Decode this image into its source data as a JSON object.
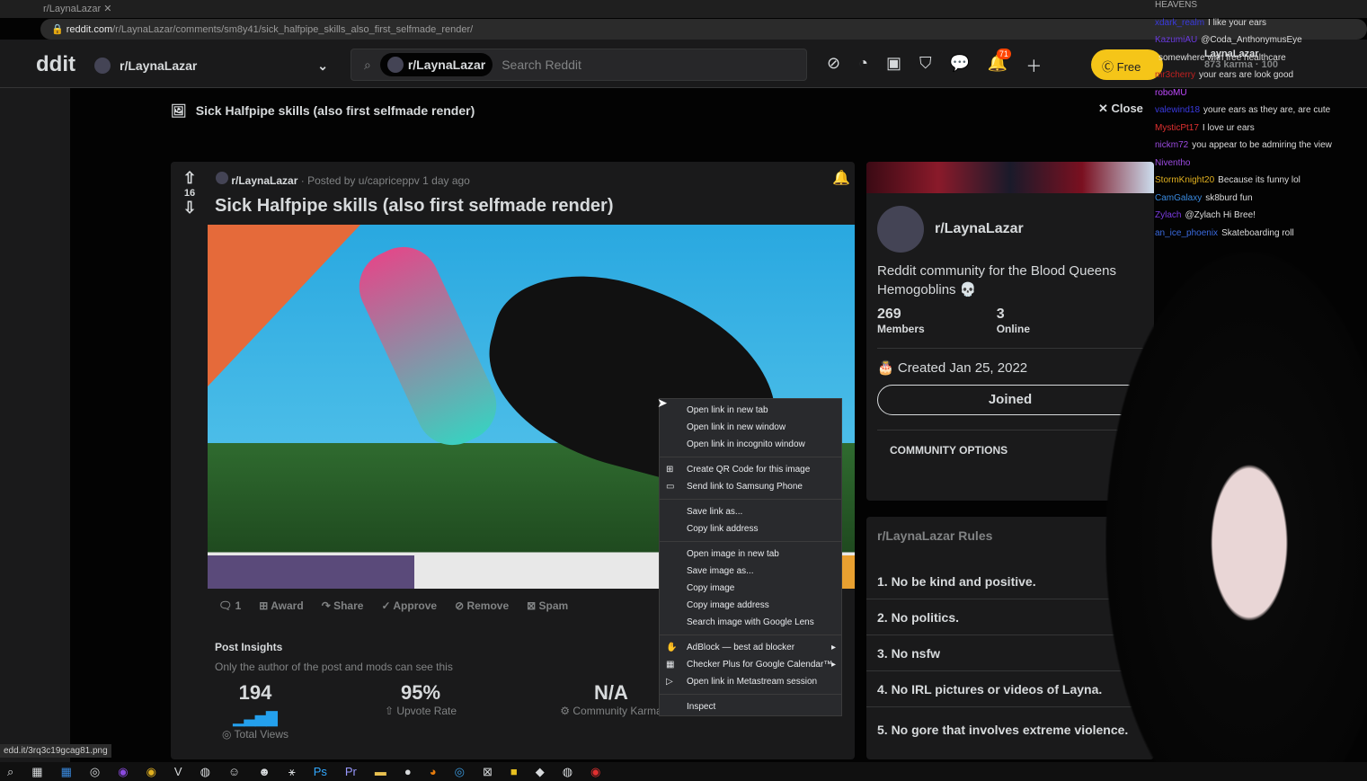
{
  "browser": {
    "tab_title": "r/LaynaLazar",
    "url_domain": "reddit.com",
    "url_path": "/r/LaynaLazar/comments/sm8y41/sick_halfpipe_skills_also_first_selfmade_render/"
  },
  "header": {
    "logo": "ddit",
    "community": "r/LaynaLazar",
    "search_scope": "r/LaynaLazar",
    "search_placeholder": "Search Reddit",
    "notifications": "71",
    "free_label": "Free",
    "user": "LaynaLazar",
    "karma": "873 karma",
    "coins": "100"
  },
  "post_header": {
    "title": "Sick Halfpipe skills (also first selfmade render)",
    "close": "Close"
  },
  "post": {
    "votes": "16",
    "subreddit": "r/LaynaLazar",
    "posted_by": "· Posted by u/capriceppv 1 day ago",
    "title": "Sick Halfpipe skills (also first selfmade render)",
    "actions": [
      {
        "icon": "comment-icon",
        "label": "1"
      },
      {
        "icon": "award-icon",
        "label": "Award"
      },
      {
        "icon": "share-icon",
        "label": "Share"
      },
      {
        "icon": "approve-icon",
        "label": "Approve"
      },
      {
        "icon": "remove-icon",
        "label": "Remove"
      },
      {
        "icon": "spam-icon",
        "label": "Spam"
      }
    ],
    "insights_title": "Post Insights",
    "insights_note": "Only the author of the post and mods can see this",
    "stats": [
      {
        "value": "194",
        "label": "Total Views"
      },
      {
        "value": "95%",
        "label": "Upvote Rate"
      },
      {
        "value": "N/A",
        "label": "Community Karma"
      }
    ]
  },
  "sidebar": {
    "name": "r/LaynaLazar",
    "description": "Reddit community for the Blood Queens Hemogoblins 💀",
    "members": "269",
    "members_label": "Members",
    "online": "3",
    "online_label": "Online",
    "created": "Created Jan 25, 2022",
    "joined": "Joined",
    "options": "COMMUNITY OPTIONS"
  },
  "rules": {
    "title": "r/LaynaLazar Rules",
    "items": [
      "1. No be kind and positive.",
      "2. No politics.",
      "3. No nsfw",
      "4. No IRL pictures or videos of Layna.",
      "5. No gore that involves extreme violence."
    ]
  },
  "context_menu": [
    [
      "Open link in new tab",
      "Open link in new window",
      "Open link in incognito window"
    ],
    [
      "Create QR Code for this image",
      "Send link to Samsung Phone"
    ],
    [
      "Save link as...",
      "Copy link address"
    ],
    [
      "Open image in new tab",
      "Save image as...",
      "Copy image",
      "Copy image address",
      "Search image with Google Lens"
    ],
    [
      "AdBlock — best ad blocker",
      "Checker Plus for Google Calendar™",
      "Open link in Metastream session"
    ],
    [
      "Inspect"
    ]
  ],
  "status_url": "edd.it/3rq3c19gcag81.png",
  "chat": [
    {
      "user": "HEAVENS",
      "msg": "",
      "color": "#aaaaaa"
    },
    {
      "user": "xdark_realm",
      "msg": "I like your ears",
      "color": "#3a3adf"
    },
    {
      "user": "KazumiAU",
      "msg": "@Coda_AnthonymusEye",
      "color": "#6a3adf"
    },
    {
      "user": "",
      "msg": "somewhere with free healthcare",
      "color": "#aaaaaa"
    },
    {
      "user": "mr3cherry",
      "msg": "your ears are look good",
      "color": "#c02020"
    },
    {
      "user": "roboMU",
      "msg": "",
      "color": "#c04aff"
    },
    {
      "user": "valewind18",
      "msg": "youre ears as they are, are cute",
      "color": "#3a3adf"
    },
    {
      "user": "MysticPt17",
      "msg": "I love ur ears",
      "color": "#e03030"
    },
    {
      "user": "nickm72",
      "msg": "you appear to be admiring the view",
      "color": "#9a4adf"
    },
    {
      "user": "Niventho",
      "msg": "",
      "color": "#9a4adf"
    },
    {
      "user": "StormKnight20",
      "msg": "Because its funny lol",
      "color": "#e0b020"
    },
    {
      "user": "CamGalaxy",
      "msg": "sk8burd fun",
      "color": "#3a8adf"
    },
    {
      "user": "Zylach",
      "msg": "@Zylach Hi Bree!",
      "color": "#7a3adf"
    },
    {
      "user": "an_ice_phoenix",
      "msg": "Skateboarding roll",
      "color": "#3a6adf"
    }
  ]
}
